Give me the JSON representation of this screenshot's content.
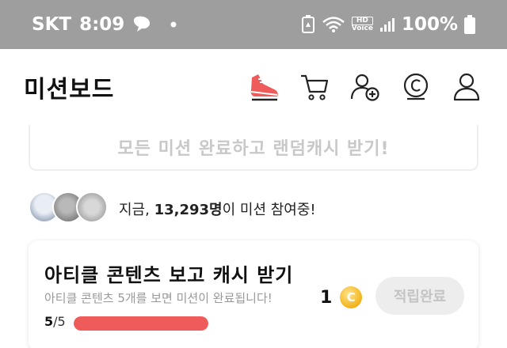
{
  "statusbar": {
    "carrier": "SKT",
    "time": "8:09",
    "hd_label": "HD",
    "voice_label": "Voice",
    "battery": "100%"
  },
  "header": {
    "title": "미션보드"
  },
  "banner": {
    "text": "모든 미션 완료하고 랜덤캐시 받기!"
  },
  "participants": {
    "prefix": "지금, ",
    "count": "13,293명",
    "suffix": "이 미션 참여중!"
  },
  "mission": {
    "title": "아티클 콘텐츠 보고 캐시 받기",
    "subtitle": "아티클 콘텐츠 5개를 보면 미션이 완료됩니다!",
    "progress_done": "5",
    "progress_total": "/5",
    "progress_fraction": 1.0,
    "reward_amount": "1",
    "coin_symbol": "C",
    "collect_label": "적립완료"
  },
  "colors": {
    "accent": "#ef5b5b",
    "coin": "#f2b31c",
    "statusbar": "#9e9e9e"
  }
}
